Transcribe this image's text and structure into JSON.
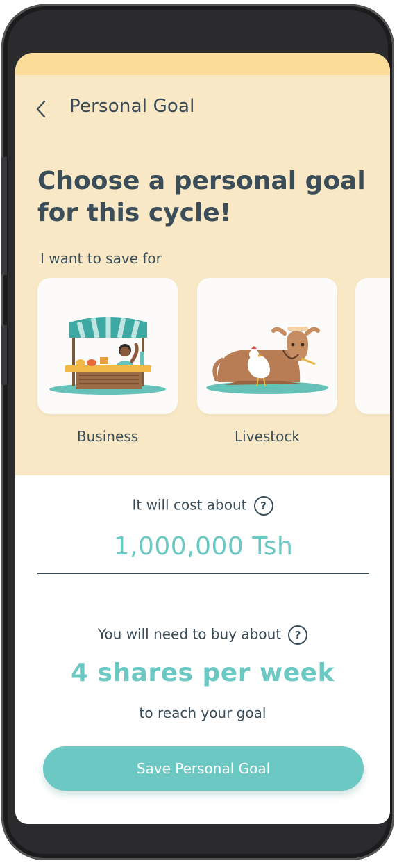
{
  "header": {
    "title": "Personal Goal"
  },
  "headline": "Choose a personal goal for this cycle!",
  "section_label": "I want to save for",
  "goals": [
    {
      "label": "Business",
      "icon": "market-stall-icon"
    },
    {
      "label": "Livestock",
      "icon": "cow-chicken-icon"
    }
  ],
  "cost": {
    "label": "It will cost about",
    "value": "1,000,000 Tsh"
  },
  "need": {
    "label": "You will need to buy about",
    "value": "4 shares per week",
    "suffix": "to reach your goal"
  },
  "help_glyph": "?",
  "save_button": "Save Personal Goal",
  "colors": {
    "accent": "#6cc8c2",
    "hero_bg": "#f8e8c6",
    "text": "#3b4d58"
  }
}
